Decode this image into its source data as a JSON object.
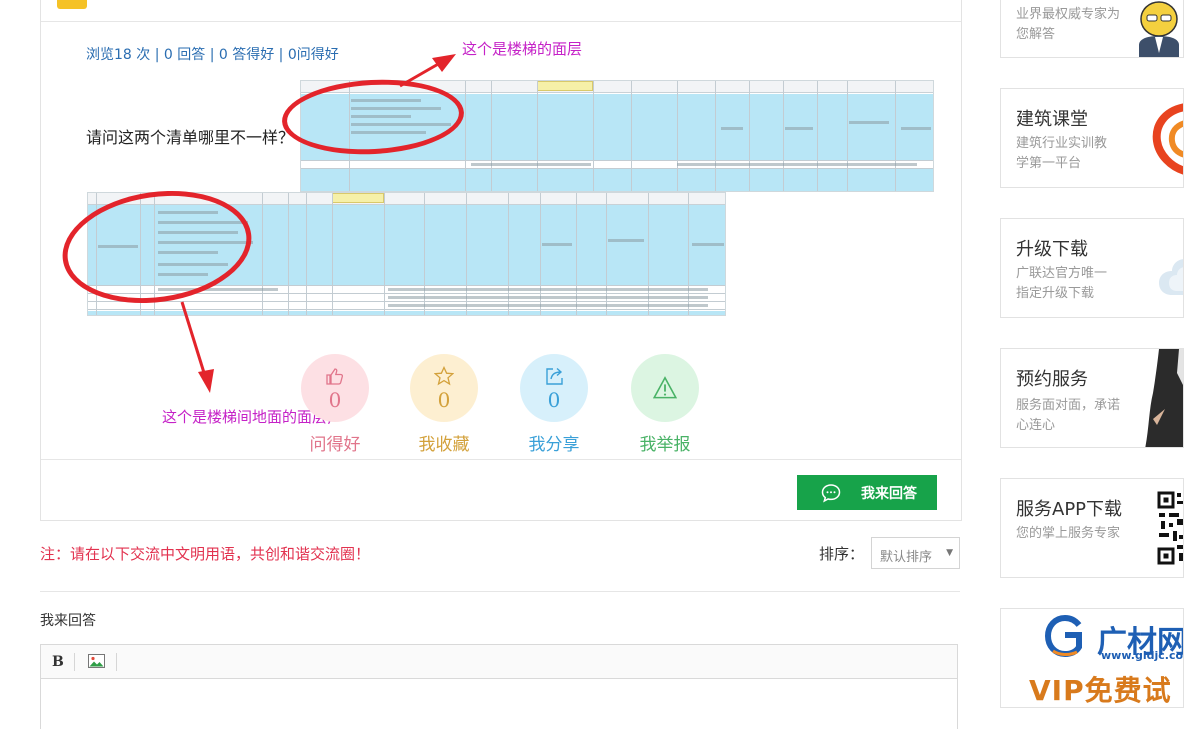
{
  "question": {
    "stats": "浏览18 次 | 0 回答 | 0 答得好 | 0问得好",
    "text": "请问这两个清单哪里不一样？",
    "annotation_top": "这个是楼梯的面层",
    "annotation_bottom": "这个是楼梯间地面的面层,"
  },
  "actions": [
    {
      "icon": "thumbs-up-icon",
      "count": "0",
      "label": "问得好"
    },
    {
      "icon": "star-icon",
      "count": "0",
      "label": "我收藏"
    },
    {
      "icon": "share-icon",
      "count": "0",
      "label": "我分享"
    },
    {
      "icon": "warning-icon",
      "label": "我举报"
    }
  ],
  "answer_button": {
    "label": "我来回答",
    "icon": "chat-icon"
  },
  "notice": "注：请在以下交流中文明用语，共创和谐交流圈！",
  "sort": {
    "label": "排序：",
    "selected": "默认排序"
  },
  "reply": {
    "title": "我来回答",
    "toolbar": {
      "bold": "B",
      "image": "image-icon"
    }
  },
  "sidebar": [
    {
      "title": "",
      "desc": "业界最权威专家为您解答"
    },
    {
      "title": "建筑课堂",
      "desc": "建筑行业实训教学第一平台"
    },
    {
      "title": "升级下载",
      "desc": "广联达官方唯一指定升级下载"
    },
    {
      "title": "预约服务",
      "desc": "服务面对面，承诺心连心"
    },
    {
      "title": "服务APP下载",
      "desc": "您的掌上服务专家"
    },
    {
      "brand": "广材网",
      "url": "www.gldjc.com",
      "promo": "VIP免费试"
    }
  ],
  "colors": {
    "link_blue": "#2a6db1",
    "annotation_magenta": "#c521c7",
    "annotation_red": "#e3242b",
    "answer_green": "#17a34a",
    "notice_red": "#e2324f"
  }
}
